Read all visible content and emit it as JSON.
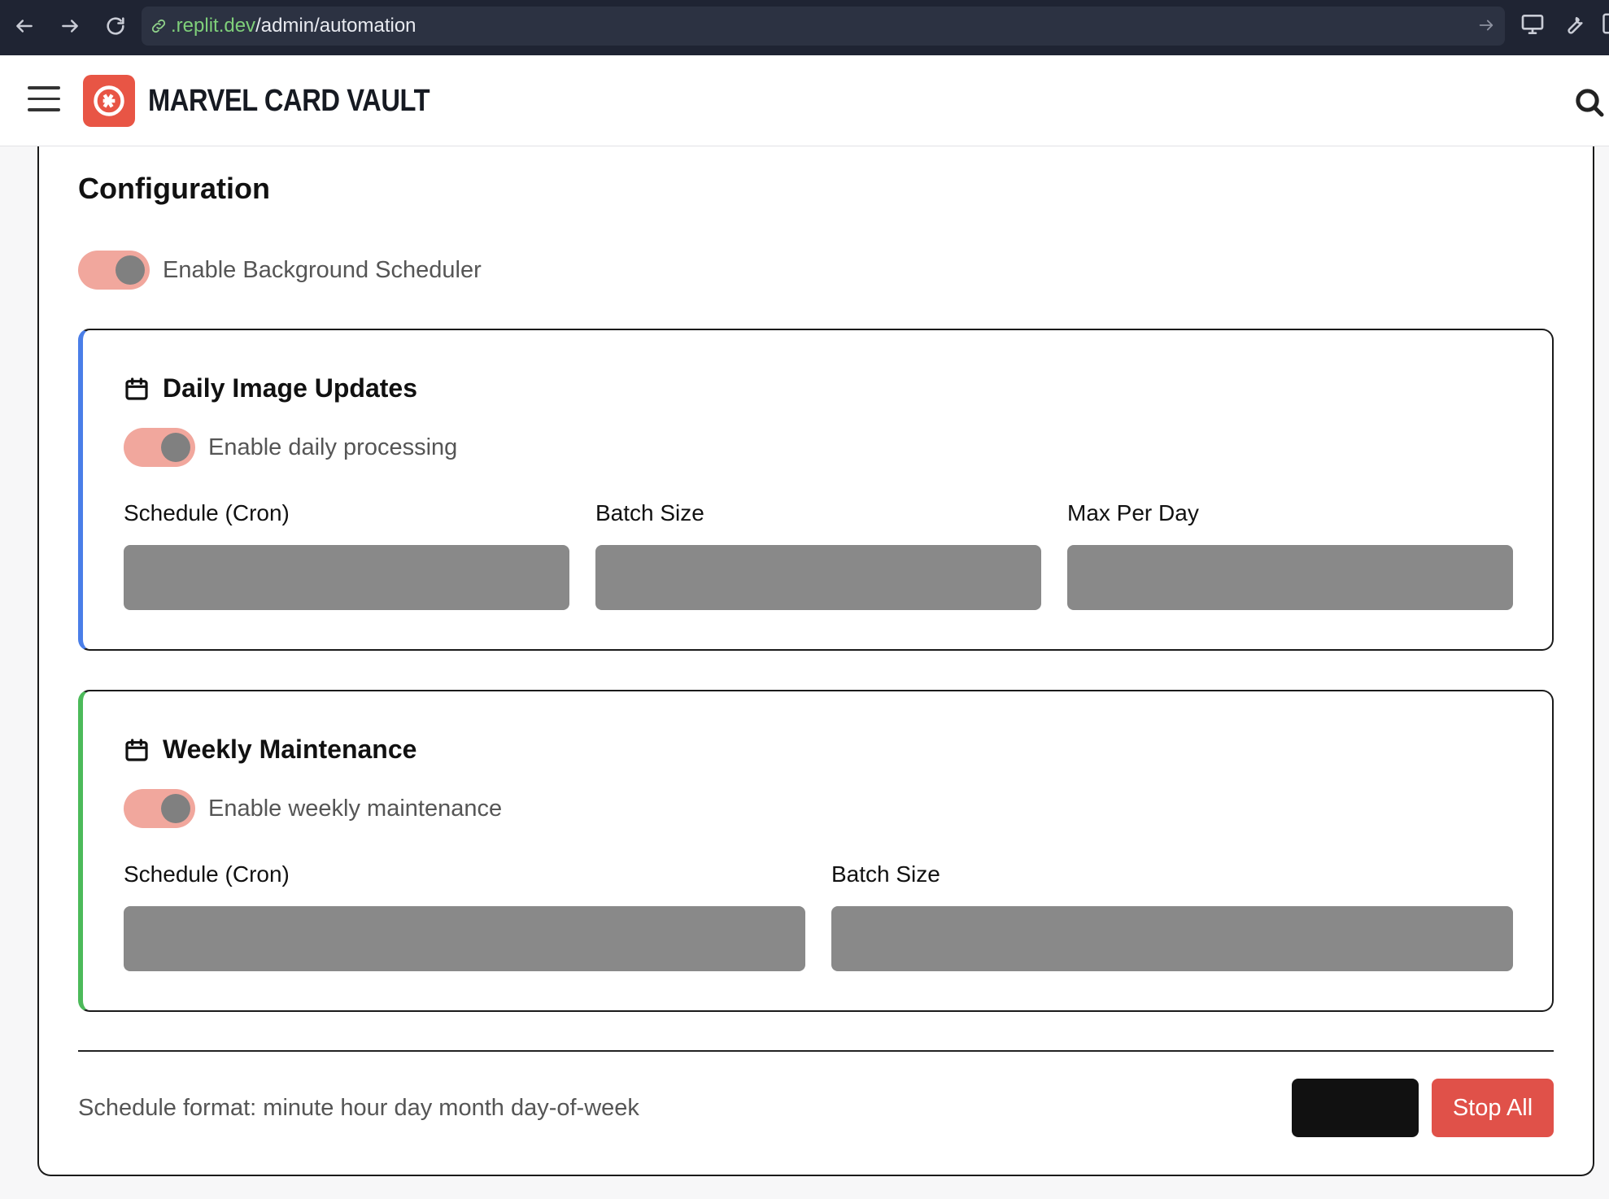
{
  "browser": {
    "url_domain": ".replit.dev",
    "url_path": "/admin/automation"
  },
  "header": {
    "brand": "MARVEL CARD VAULT"
  },
  "config": {
    "title": "Configuration",
    "scheduler_toggle_label": "Enable Background Scheduler",
    "scheduler_enabled": true
  },
  "daily": {
    "title": "Daily Image Updates",
    "toggle_label": "Enable daily processing",
    "enabled": true,
    "schedule_label": "Schedule (Cron)",
    "batch_label": "Batch Size",
    "max_label": "Max Per Day",
    "schedule_value": "",
    "batch_value": "",
    "max_value": ""
  },
  "weekly": {
    "title": "Weekly Maintenance",
    "toggle_label": "Enable weekly maintenance",
    "enabled": true,
    "schedule_label": "Schedule (Cron)",
    "batch_label": "Batch Size",
    "schedule_value": "",
    "batch_value": ""
  },
  "footer": {
    "note": "Schedule format: minute hour day month day-of-week",
    "primary_label": "",
    "stop_label": "Stop All"
  },
  "colors": {
    "accent": "#e85545",
    "toggle_track": "#f1a79d",
    "daily_border": "#4a7ee8",
    "weekly_border": "#4cba5a",
    "stop_button": "#e05149"
  }
}
